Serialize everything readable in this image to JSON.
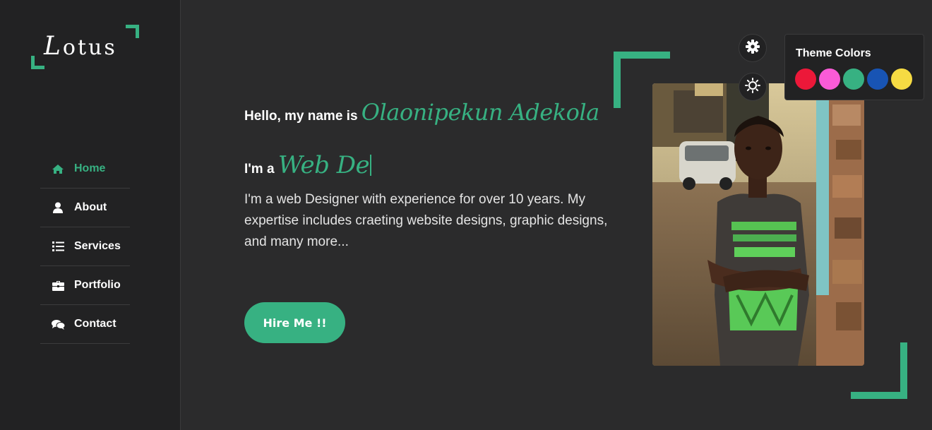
{
  "brand": {
    "logo_initial": "L",
    "logo_rest": "otus"
  },
  "nav": {
    "items": [
      {
        "label": "Home",
        "icon": "home-icon",
        "active": true
      },
      {
        "label": "About",
        "icon": "user-icon",
        "active": false
      },
      {
        "label": "Services",
        "icon": "list-icon",
        "active": false
      },
      {
        "label": "Portfolio",
        "icon": "briefcase-icon",
        "active": false
      },
      {
        "label": "Contact",
        "icon": "comments-icon",
        "active": false
      }
    ]
  },
  "intro": {
    "hello_prefix": "Hello, my name is",
    "name": "Olaonipekun Adekola",
    "typing_prefix": "I'm a",
    "typing_text": "Web De",
    "description": "I'm a web Designer with experience for over 10 years. My expertise includes craeting website designs, graphic designs, and many more...",
    "hire_label": "Hire Me !!"
  },
  "switcher": {
    "gear_icon": "gear-icon",
    "day_night_icon": "sun-icon",
    "title": "Theme Colors",
    "colors": [
      "#ec1839",
      "#fa5bd7",
      "#37b182",
      "#1854b4",
      "#f6db43"
    ]
  },
  "theme": {
    "accent": "#37b182",
    "background": "#2b2b2c",
    "sidebar": "#222223"
  }
}
